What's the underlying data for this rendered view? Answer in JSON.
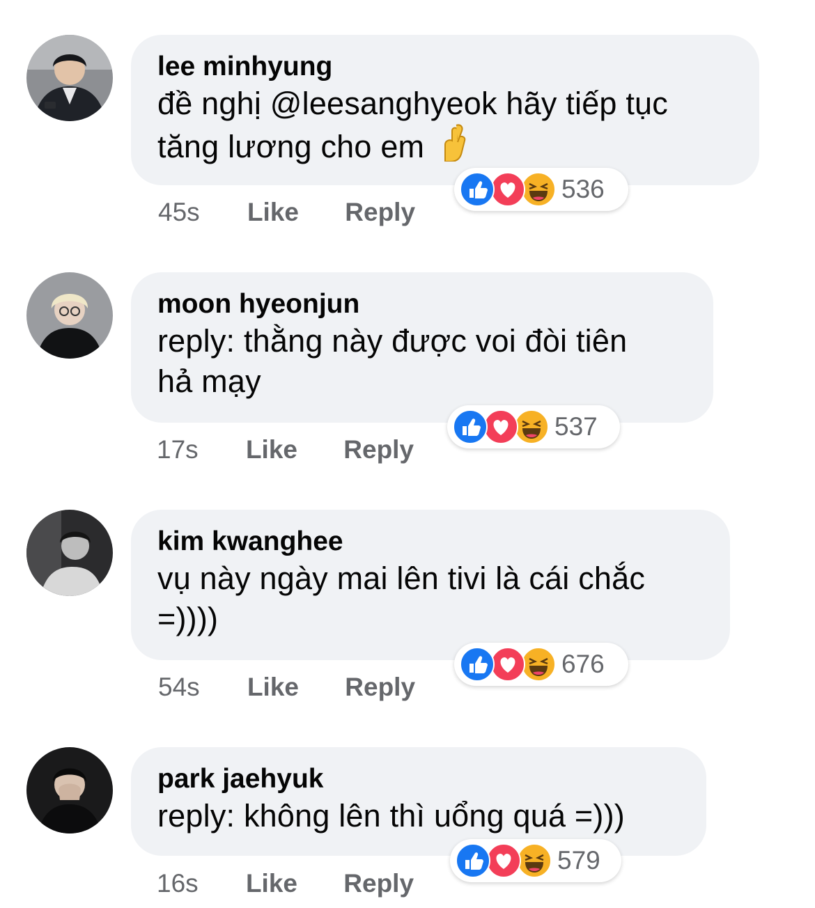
{
  "comments": [
    {
      "author": "lee minhyung",
      "text_lines": [
        "đề nghị @leesanghyeok hãy tiếp tục",
        "tăng lương cho em"
      ],
      "time": "45s",
      "like_label": "Like",
      "reply_label": "Reply",
      "reaction_count": "536",
      "reactions": [
        "like-icon",
        "love-icon",
        "haha-icon"
      ],
      "inline_emoji": "crossed-fingers-icon"
    },
    {
      "author": "moon hyeonjun",
      "text_lines": [
        "reply: thằng này được voi đòi tiên",
        "hả mạy"
      ],
      "time": "17s",
      "like_label": "Like",
      "reply_label": "Reply",
      "reaction_count": "537",
      "reactions": [
        "like-icon",
        "love-icon",
        "haha-icon"
      ]
    },
    {
      "author": "kim kwanghee",
      "text_lines": [
        "vụ này ngày mai lên tivi là cái chắc",
        "=))))"
      ],
      "time": "54s",
      "like_label": "Like",
      "reply_label": "Reply",
      "reaction_count": "676",
      "reactions": [
        "like-icon",
        "love-icon",
        "haha-icon"
      ]
    },
    {
      "author": "park jaehyuk",
      "text_lines": [
        "reply: không lên thì uổng quá =)))"
      ],
      "time": "16s",
      "like_label": "Like",
      "reply_label": "Reply",
      "reaction_count": "579",
      "reactions": [
        "like-icon",
        "love-icon",
        "haha-icon"
      ]
    }
  ],
  "colors": {
    "bubble": "#f0f2f5",
    "meta_text": "#65676b",
    "like_blue": "#1877f2",
    "love_red": "#f33e58",
    "haha_yellow": "#f7b125"
  }
}
